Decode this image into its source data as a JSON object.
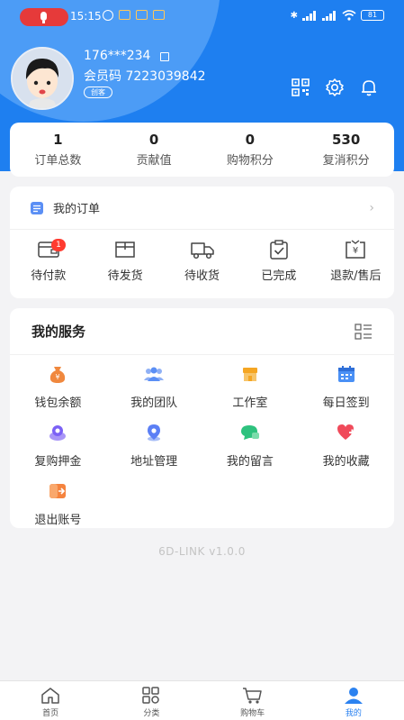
{
  "status_bar": {
    "time": "15:15",
    "battery": "81"
  },
  "profile": {
    "phone": "176***234",
    "member_code": "会员码 7223039842",
    "role": "创客"
  },
  "stats": [
    {
      "value": "1",
      "label": "订单总数"
    },
    {
      "value": "0",
      "label": "贡献值"
    },
    {
      "value": "0",
      "label": "购物积分"
    },
    {
      "value": "530",
      "label": "复消积分"
    }
  ],
  "orders": {
    "title": "我的订单",
    "items": [
      {
        "label": "待付款",
        "icon": "wallet-icon",
        "badge": "1"
      },
      {
        "label": "待发货",
        "icon": "package-icon"
      },
      {
        "label": "待收货",
        "icon": "truck-icon"
      },
      {
        "label": "已完成",
        "icon": "clipboard-check-icon"
      },
      {
        "label": "退款/售后",
        "icon": "refund-icon"
      }
    ]
  },
  "services": {
    "title": "我的服务",
    "items": [
      {
        "label": "钱包余额",
        "icon": "money-bag-icon",
        "color": "#f0883e"
      },
      {
        "label": "我的团队",
        "icon": "team-icon",
        "color": "#5b8ff5"
      },
      {
        "label": "工作室",
        "icon": "shop-icon",
        "color": "#f5a623"
      },
      {
        "label": "每日签到",
        "icon": "calendar-icon",
        "color": "#4a90f5"
      },
      {
        "label": "复购押金",
        "icon": "deposit-icon",
        "color": "#7b61f5"
      },
      {
        "label": "地址管理",
        "icon": "location-icon",
        "color": "#5b7ff5"
      },
      {
        "label": "我的留言",
        "icon": "message-icon",
        "color": "#2ec27e"
      },
      {
        "label": "我的收藏",
        "icon": "heart-icon",
        "color": "#f04a5a"
      },
      {
        "label": "退出账号",
        "icon": "logout-icon",
        "color": "#f5833e"
      }
    ]
  },
  "version": "6D-LINK v1.0.0",
  "tabs": [
    {
      "label": "首页",
      "icon": "home-icon"
    },
    {
      "label": "分类",
      "icon": "category-icon"
    },
    {
      "label": "购物车",
      "icon": "cart-icon"
    },
    {
      "label": "我的",
      "icon": "user-icon",
      "active": true
    }
  ],
  "colors": {
    "primary": "#1e7ff0",
    "badge": "#ff3b30"
  }
}
